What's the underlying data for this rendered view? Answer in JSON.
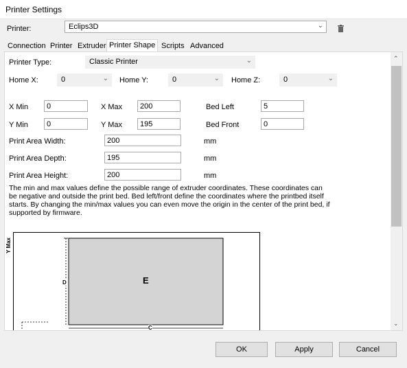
{
  "window": {
    "title": "Printer Settings"
  },
  "printer_row": {
    "label": "Printer:",
    "selected": "Eclips3D"
  },
  "tabs": [
    {
      "label": "Connection"
    },
    {
      "label": "Printer"
    },
    {
      "label": "Extruder"
    },
    {
      "label": "Printer Shape",
      "active": true
    },
    {
      "label": "Scripts"
    },
    {
      "label": "Advanced"
    }
  ],
  "shape": {
    "printer_type": {
      "label": "Printer Type:",
      "value": "Classic Printer"
    },
    "home_x": {
      "label": "Home X:",
      "value": "0"
    },
    "home_y": {
      "label": "Home Y:",
      "value": "0"
    },
    "home_z": {
      "label": "Home Z:",
      "value": "0"
    },
    "x_min": {
      "label": "X Min",
      "value": "0"
    },
    "x_max": {
      "label": "X Max",
      "value": "200"
    },
    "bed_left": {
      "label": "Bed Left",
      "value": "5"
    },
    "y_min": {
      "label": "Y Min",
      "value": "0"
    },
    "y_max": {
      "label": "Y Max",
      "value": "195"
    },
    "bed_front": {
      "label": "Bed Front",
      "value": "0"
    },
    "area_width": {
      "label": "Print Area Width:",
      "value": "200",
      "unit": "mm"
    },
    "area_depth": {
      "label": "Print Area Depth:",
      "value": "195",
      "unit": "mm"
    },
    "area_height": {
      "label": "Print Area Height:",
      "value": "200",
      "unit": "mm"
    },
    "description": "The min and max values define the possible range of extruder coordinates. These coordinates can be negative and outside the print bed. Bed left/front define the coordinates where the printbed itself starts. By changing the min/max values you can even move the origin in the center of the print bed, if supported by firmware."
  },
  "diagram": {
    "axis_label": "Y Max",
    "label_d": "D",
    "label_e": "E",
    "label_c": "C"
  },
  "buttons": {
    "ok": "OK",
    "apply": "Apply",
    "cancel": "Cancel"
  },
  "icons": {
    "trash": "trash-icon",
    "chevron": "chevron-down-icon"
  }
}
